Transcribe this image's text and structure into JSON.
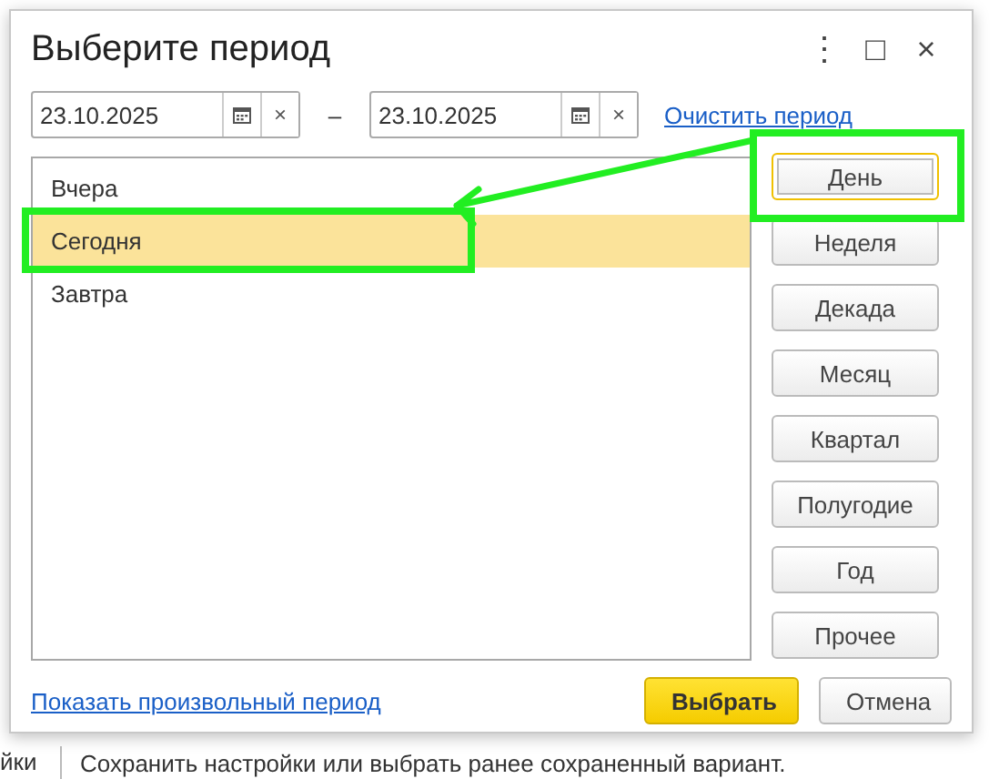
{
  "background": {
    "side_label": "йки",
    "hint": "Сохранить настройки или выбрать ранее сохраненный вариант."
  },
  "window": {
    "title": "Выберите период",
    "controls": [
      "⋮",
      "□",
      "×"
    ]
  },
  "period": {
    "start": "23.10.2025",
    "separator": "–",
    "end": "23.10.2025",
    "clear_glyph": "×",
    "clear_link": "Очистить период"
  },
  "list": [
    {
      "label": "Вчера",
      "selected": false
    },
    {
      "label": "Сегодня",
      "selected": true
    },
    {
      "label": "Завтра",
      "selected": false
    }
  ],
  "period_buttons": [
    {
      "label": "День",
      "focused": true
    },
    {
      "label": "Неделя",
      "focused": false
    },
    {
      "label": "Декада",
      "focused": false
    },
    {
      "label": "Месяц",
      "focused": false
    },
    {
      "label": "Квартал",
      "focused": false
    },
    {
      "label": "Полугодие",
      "focused": false
    },
    {
      "label": "Год",
      "focused": false
    },
    {
      "label": "Прочее",
      "focused": false
    }
  ],
  "footer": {
    "link": "Показать произвольный период",
    "buttons": [
      {
        "label": "Выбрать",
        "kind": "primary"
      },
      {
        "label": "Отмена",
        "kind": "normal"
      }
    ]
  },
  "annotation": {
    "highlight": true,
    "color": "#22ee22"
  }
}
